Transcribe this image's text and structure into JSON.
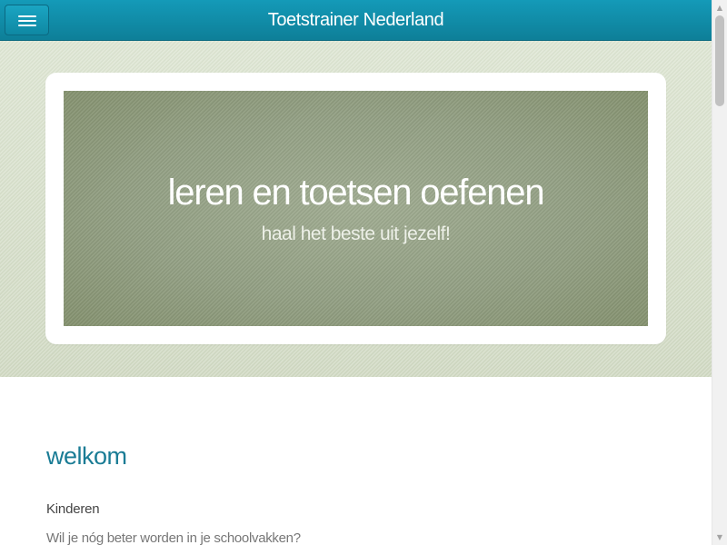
{
  "topbar": {
    "title": "Toetstrainer Nederland",
    "menu_icon": "hamburger-menu-icon",
    "accent_color": "#0f8aa6"
  },
  "hero": {
    "title": "leren en toetsen oefenen",
    "subtitle": "haal het beste uit jezelf!",
    "background_color": "#d5ddc8",
    "panel_color": "#8e9c7e"
  },
  "content": {
    "heading": "welkom",
    "label": "Kinderen",
    "question": "Wil je nóg beter worden in je schoolvakken?",
    "heading_color": "#1a7c95"
  },
  "scrollbar": {
    "up_icon": "scroll-up-arrow-icon",
    "down_icon": "scroll-down-arrow-icon"
  }
}
